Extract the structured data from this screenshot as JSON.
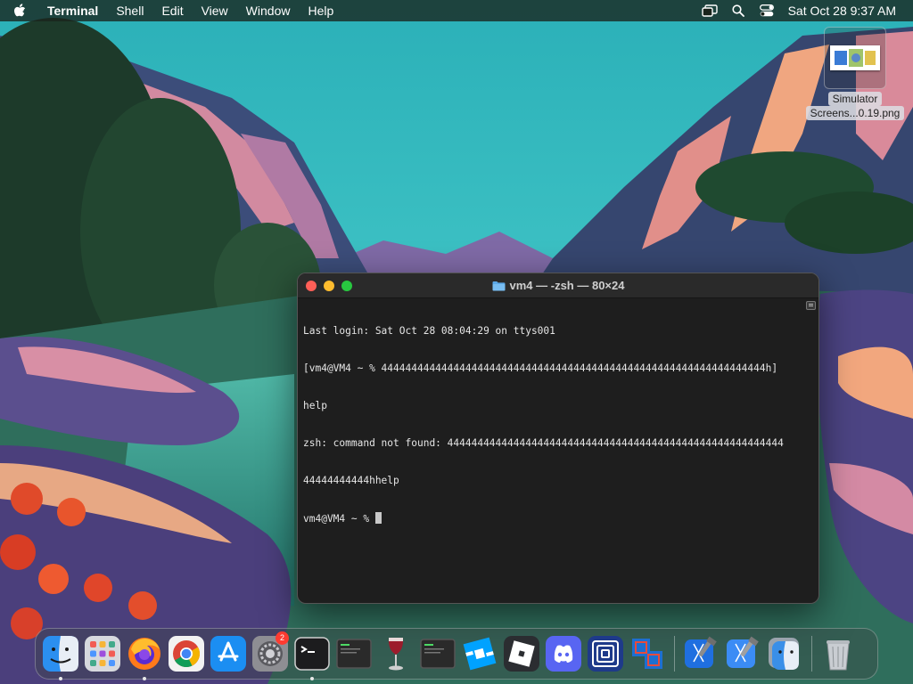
{
  "menubar": {
    "app_name": "Terminal",
    "menus": [
      "Shell",
      "Edit",
      "View",
      "Window",
      "Help"
    ],
    "clock": "Sat Oct 28  9:37 AM",
    "status_icons": [
      "screen-mirroring-icon",
      "spotlight-search-icon",
      "control-center-icon"
    ]
  },
  "desktop": {
    "file": {
      "name_line1": "Simulator",
      "name_line2": "Screens...0.19.png",
      "icon": "png-thumbnail-icon"
    }
  },
  "terminal": {
    "title": "vm4 — -zsh — 80×24",
    "lines": [
      "Last login: Sat Oct 28 08:04:29 on ttys001",
      "[vm4@VM4 ~ % 4444444444444444444444444444444444444444444444444444444444444444h]",
      "help",
      "zsh: command not found: 44444444444444444444444444444444444444444444444444444444",
      "44444444444hhelp",
      "vm4@VM4 ~ % "
    ]
  },
  "dock": {
    "items": [
      {
        "name": "Finder",
        "icon": "finder-icon",
        "running": true
      },
      {
        "name": "Launchpad",
        "icon": "launchpad-icon",
        "running": false
      },
      {
        "name": "Firefox",
        "icon": "firefox-icon",
        "running": true
      },
      {
        "name": "Google Chrome",
        "icon": "chrome-icon",
        "running": false
      },
      {
        "name": "App Store",
        "icon": "app-store-icon",
        "running": false
      },
      {
        "name": "System Settings",
        "icon": "system-settings-icon",
        "running": false,
        "badge": "2"
      },
      {
        "name": "Terminal",
        "icon": "terminal-icon",
        "running": true
      },
      {
        "name": "Console",
        "icon": "console-icon",
        "running": false
      },
      {
        "name": "Wine",
        "icon": "wine-icon",
        "running": false
      },
      {
        "name": "Console 2",
        "icon": "console-icon",
        "running": false
      },
      {
        "name": "Roblox Studio",
        "icon": "roblox-studio-icon",
        "running": false
      },
      {
        "name": "Roblox",
        "icon": "roblox-icon",
        "running": false
      },
      {
        "name": "Discord",
        "icon": "discord-icon",
        "running": false
      },
      {
        "name": "Sonar",
        "icon": "concentric-squares-icon",
        "running": false
      },
      {
        "name": "VirtualBox",
        "icon": "virtualbox-icon",
        "running": false
      },
      {
        "name": "Xcode",
        "icon": "xcode-icon",
        "running": false
      },
      {
        "name": "Xcode Beta",
        "icon": "xcode-beta-icon",
        "running": false
      },
      {
        "name": "Finder Alt",
        "icon": "finder-alt-icon",
        "running": false
      },
      {
        "name": "Trash",
        "icon": "trash-icon",
        "running": false
      }
    ]
  },
  "colors": {
    "terminal_bg": "#1e1e1e",
    "close": "#ff5f57",
    "minimize": "#febc2e",
    "zoom": "#28c840",
    "badge": "#ff3b30"
  }
}
